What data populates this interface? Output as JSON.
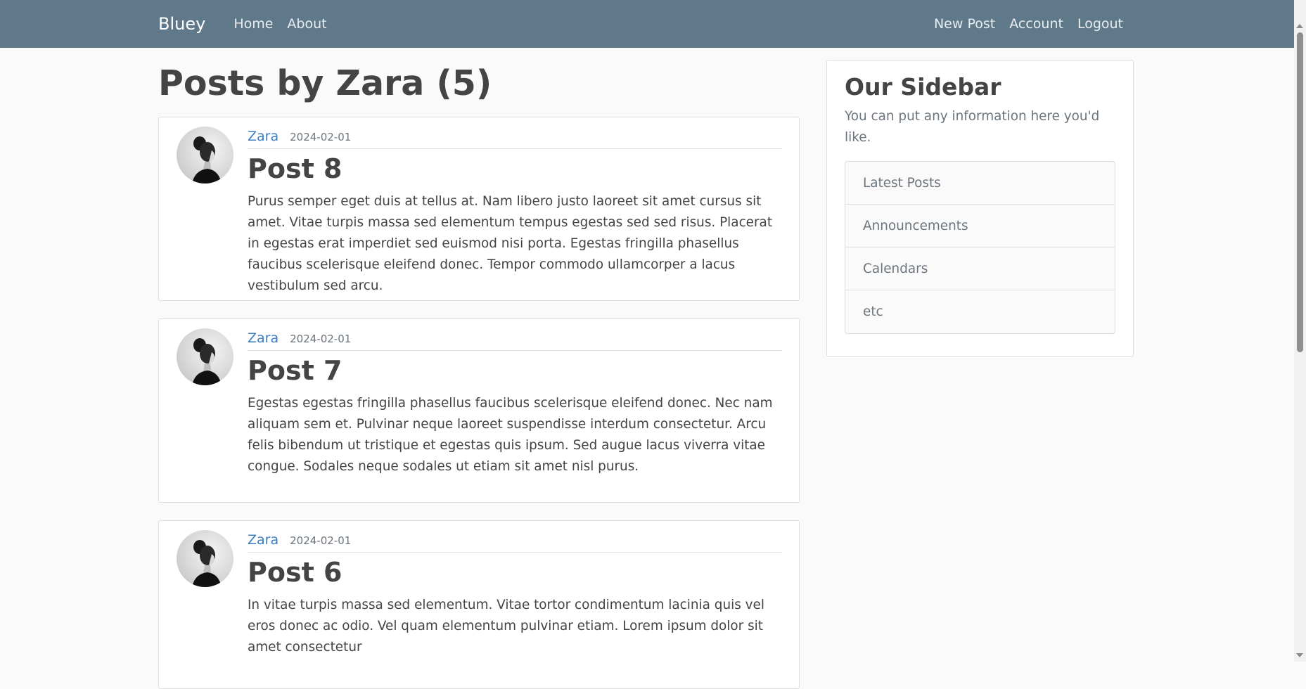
{
  "nav": {
    "brand": "Bluey",
    "links": [
      "Home",
      "About"
    ],
    "right_links": [
      "New Post",
      "Account",
      "Logout"
    ]
  },
  "page": {
    "title": "Posts by Zara (5)"
  },
  "posts": [
    {
      "author": "Zara",
      "date": "2024-02-01",
      "title": "Post 8",
      "content": "Purus semper eget duis at tellus at. Nam libero justo laoreet sit amet cursus sit amet. Vitae turpis massa sed elementum tempus egestas sed sed risus. Placerat in egestas erat imperdiet sed euismod nisi porta. Egestas fringilla phasellus faucibus scelerisque eleifend donec. Tempor commodo ullamcorper a lacus vestibulum sed arcu."
    },
    {
      "author": "Zara",
      "date": "2024-02-01",
      "title": "Post 7",
      "content": "Egestas egestas fringilla phasellus faucibus scelerisque eleifend donec. Nec nam aliquam sem et. Pulvinar neque laoreet suspendisse interdum consectetur. Arcu felis bibendum ut tristique et egestas quis ipsum. Sed augue lacus viverra vitae congue. Sodales neque sodales ut etiam sit amet nisl purus."
    },
    {
      "author": "Zara",
      "date": "2024-02-01",
      "title": "Post 6",
      "content": "In vitae turpis massa sed elementum. Vitae tortor condimentum lacinia quis vel eros donec ac odio. Vel quam elementum pulvinar etiam. Lorem ipsum dolor sit amet consectetur"
    }
  ],
  "sidebar": {
    "title": "Our Sidebar",
    "description": "You can put any information here you'd like.",
    "items": [
      "Latest Posts",
      "Announcements",
      "Calendars",
      "etc"
    ]
  }
}
